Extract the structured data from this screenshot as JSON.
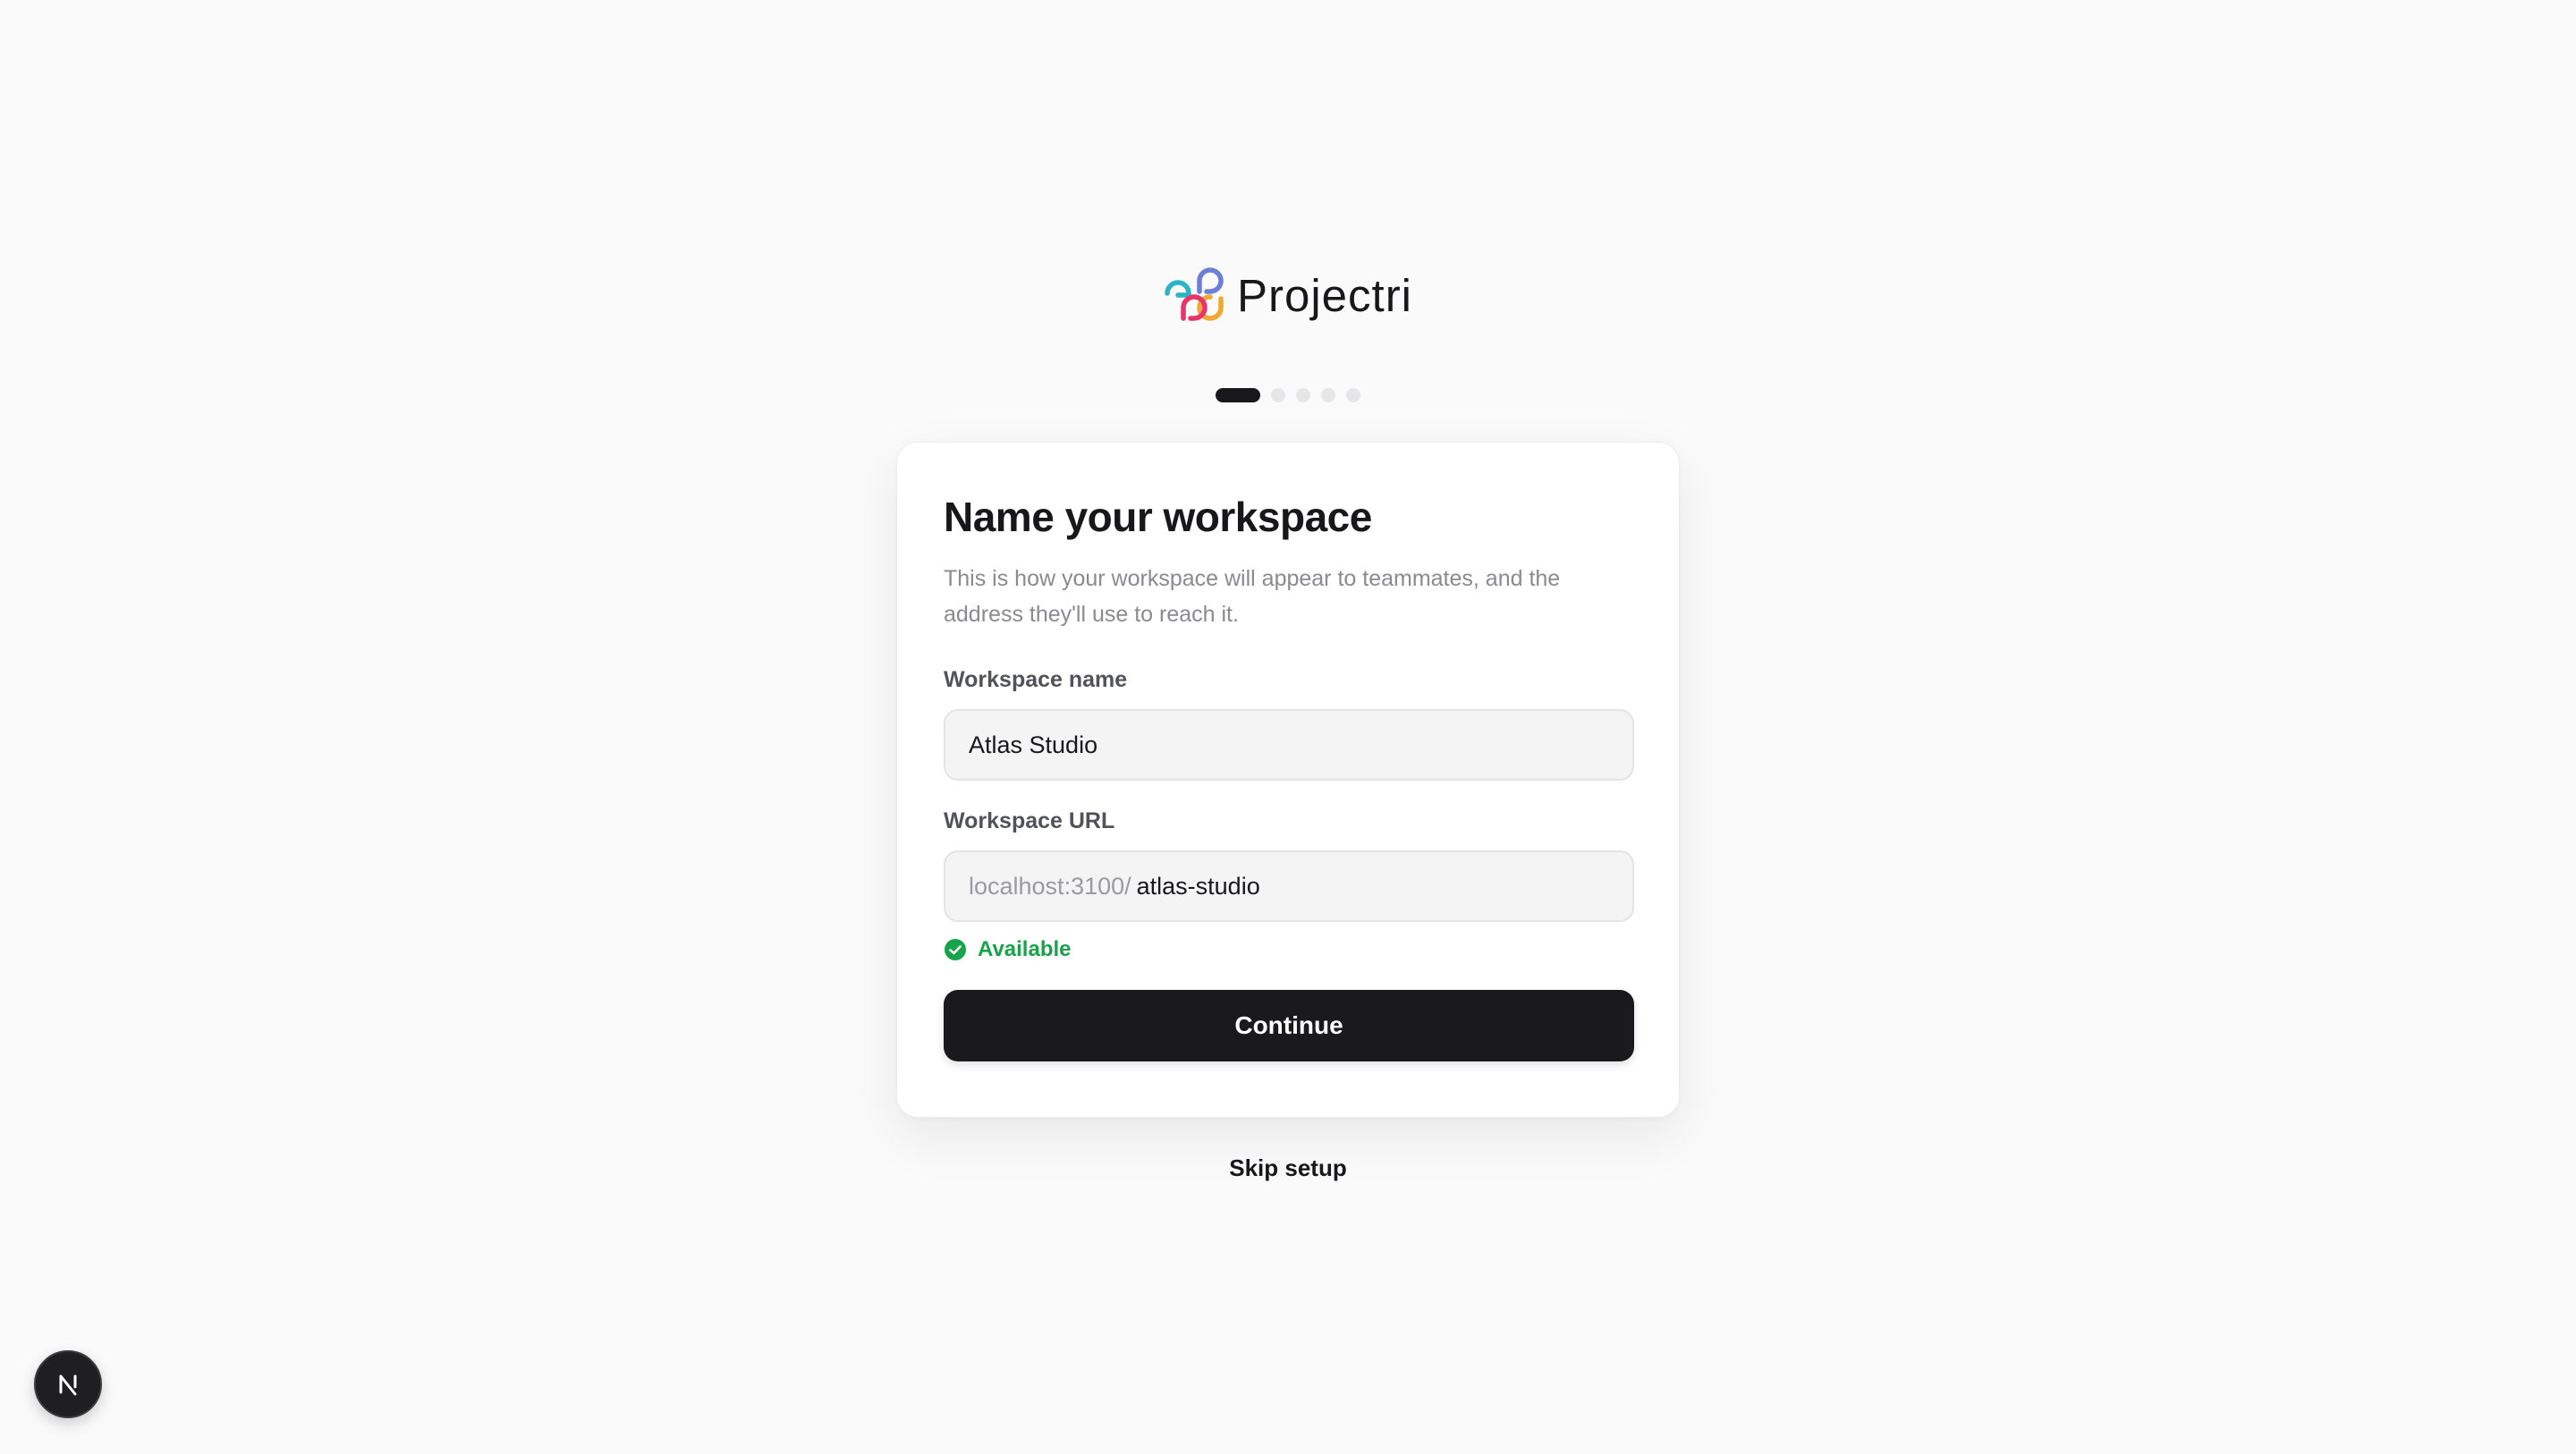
{
  "brand": {
    "name": "Projectri",
    "colors": [
      "#2bb5c4",
      "#6b7fd6",
      "#f0a830",
      "#e8336b"
    ]
  },
  "steps": {
    "total": 5,
    "current": 1
  },
  "card": {
    "title": "Name your workspace",
    "description": "This is how your workspace will appear to teammates, and the address they'll use to reach it."
  },
  "fields": {
    "name": {
      "label": "Workspace name",
      "value": "Atlas Studio"
    },
    "url": {
      "label": "Workspace URL",
      "prefix": "localhost:3100/",
      "value": "atlas-studio"
    }
  },
  "status": {
    "text": "Available",
    "color": "#16a34a"
  },
  "actions": {
    "continue_label": "Continue",
    "skip_label": "Skip setup"
  },
  "dev_badge": {
    "icon": "nextjs-icon",
    "letter": "N"
  }
}
